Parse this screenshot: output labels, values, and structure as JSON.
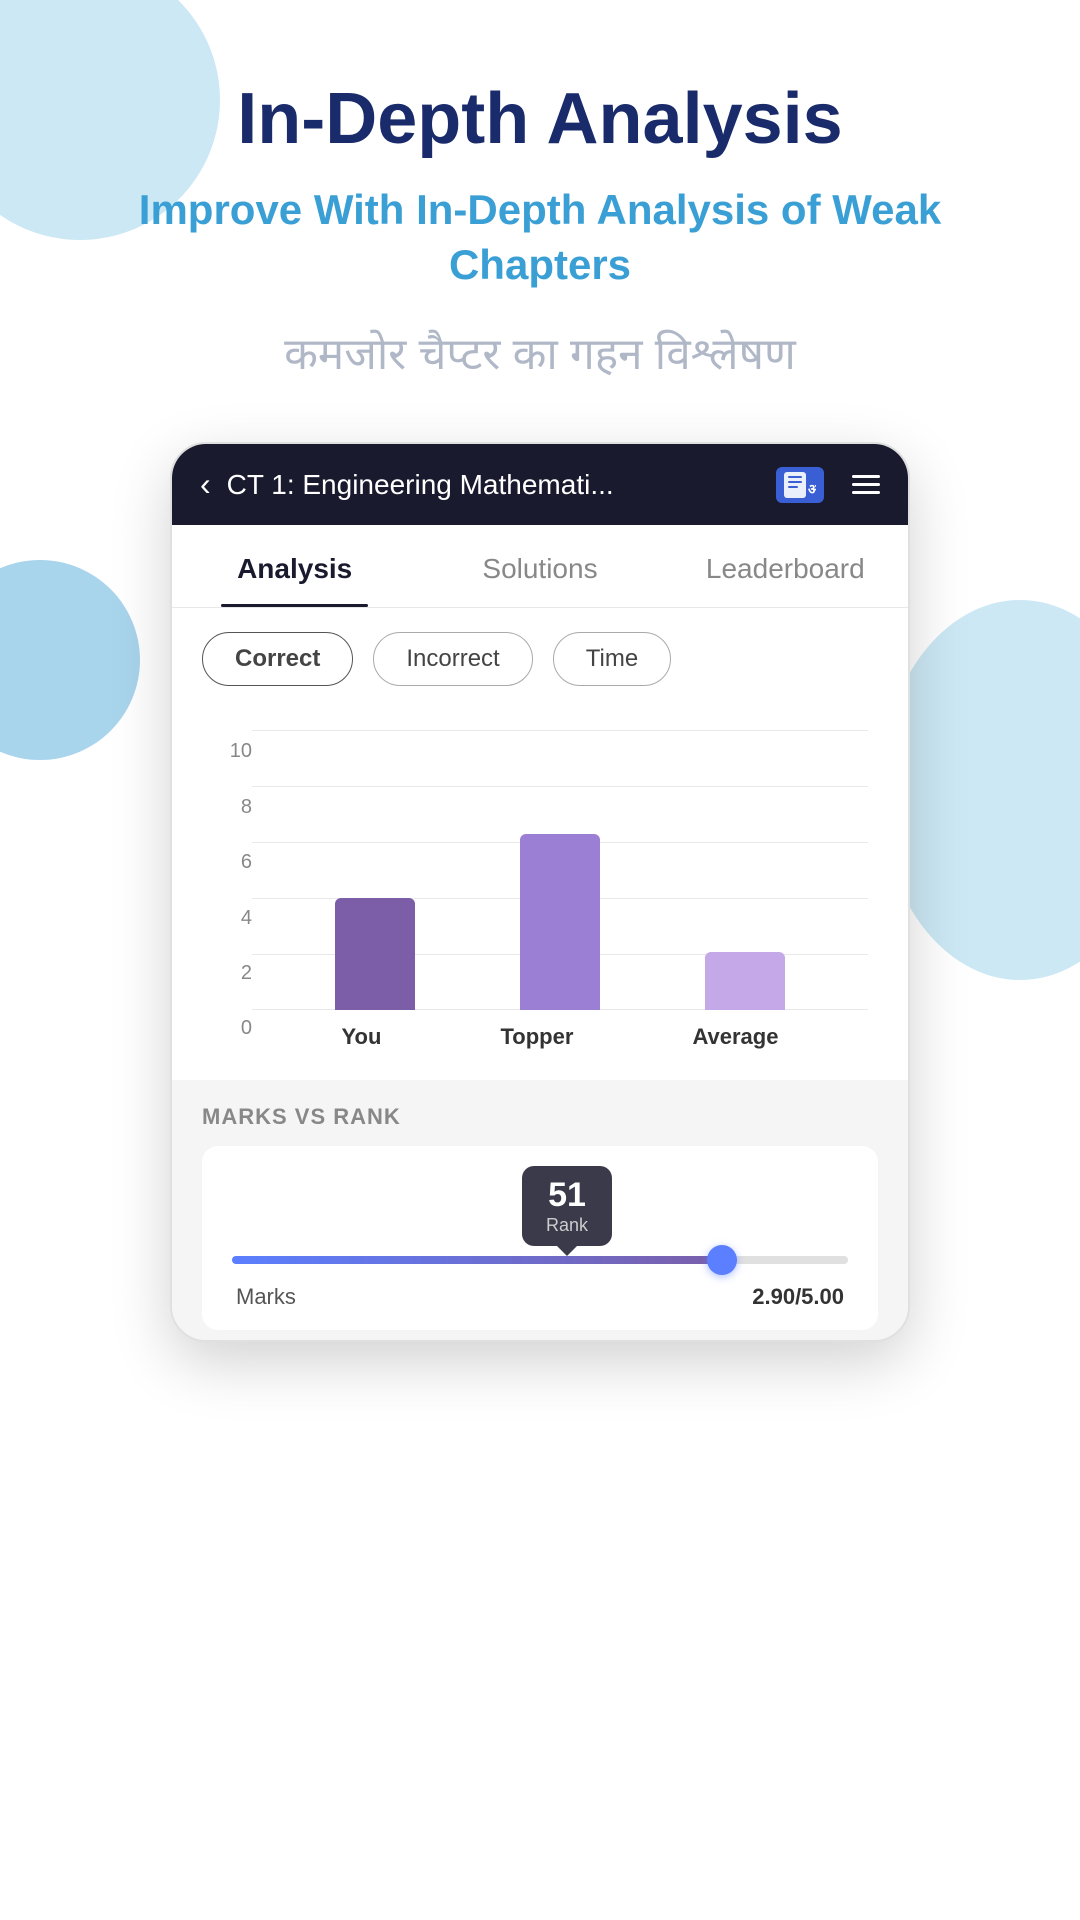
{
  "page": {
    "main_title": "In-Depth Analysis",
    "subtitle": "Improve With In-Depth Analysis of Weak Chapters",
    "hindi_text": "कमजोर चैप्टर का गहन विश्लेषण"
  },
  "topbar": {
    "title": "CT 1: Engineering Mathemati...",
    "back_icon": "‹",
    "menu_icon": "☰"
  },
  "tabs": [
    {
      "label": "Analysis",
      "active": true
    },
    {
      "label": "Solutions",
      "active": false
    },
    {
      "label": "Leaderboard",
      "active": false
    }
  ],
  "filters": [
    {
      "label": "Correct",
      "active": true
    },
    {
      "label": "Incorrect",
      "active": false
    },
    {
      "label": "Time",
      "active": false
    }
  ],
  "chart": {
    "y_labels": [
      "10",
      "8",
      "6",
      "4",
      "2",
      "0"
    ],
    "bars": [
      {
        "label": "You",
        "height_percent": 35,
        "color": "#7b5ea7"
      },
      {
        "label": "Topper",
        "height_percent": 55,
        "color": "#9b7fd4"
      },
      {
        "label": "Average",
        "height_percent": 18,
        "color": "#c4a8e8"
      }
    ]
  },
  "marks_vs_rank": {
    "section_title": "MARKS VS RANK",
    "rank_number": "51",
    "rank_label": "Rank",
    "marks_label": "Marks",
    "marks_value": "2.90/5.00",
    "slider_fill_percent": 82
  }
}
